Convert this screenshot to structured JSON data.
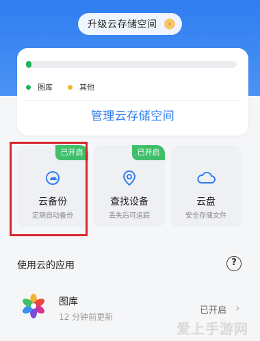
{
  "header": {
    "upgrade_label": "升级云存储空间",
    "chevron": "›"
  },
  "storage": {
    "used_fraction": 0.02,
    "legend": [
      {
        "label": "图库",
        "color": "#22b35a"
      },
      {
        "label": "其他",
        "color": "#f3b533"
      }
    ],
    "manage_label": "管理云存储空间"
  },
  "features": [
    {
      "title": "云备份",
      "subtitle": "定期自动备份",
      "badge": "已开启",
      "icon": "cloud-backup-icon"
    },
    {
      "title": "查找设备",
      "subtitle": "丢失后可追踪",
      "badge": "已开启",
      "icon": "location-pin-icon"
    },
    {
      "title": "云盘",
      "subtitle": "安全存储文件",
      "badge": "",
      "icon": "cloud-drive-icon"
    }
  ],
  "apps_section": {
    "title": "使用云的应用",
    "help": "?"
  },
  "apps": [
    {
      "name": "图库",
      "updated": "12 分钟前更新",
      "status": "已开启"
    }
  ],
  "watermark": "爱上手游网",
  "colors": {
    "accent": "#2f7df0",
    "badge_green": "#3fbf6a",
    "highlight_red": "#d6262a"
  }
}
